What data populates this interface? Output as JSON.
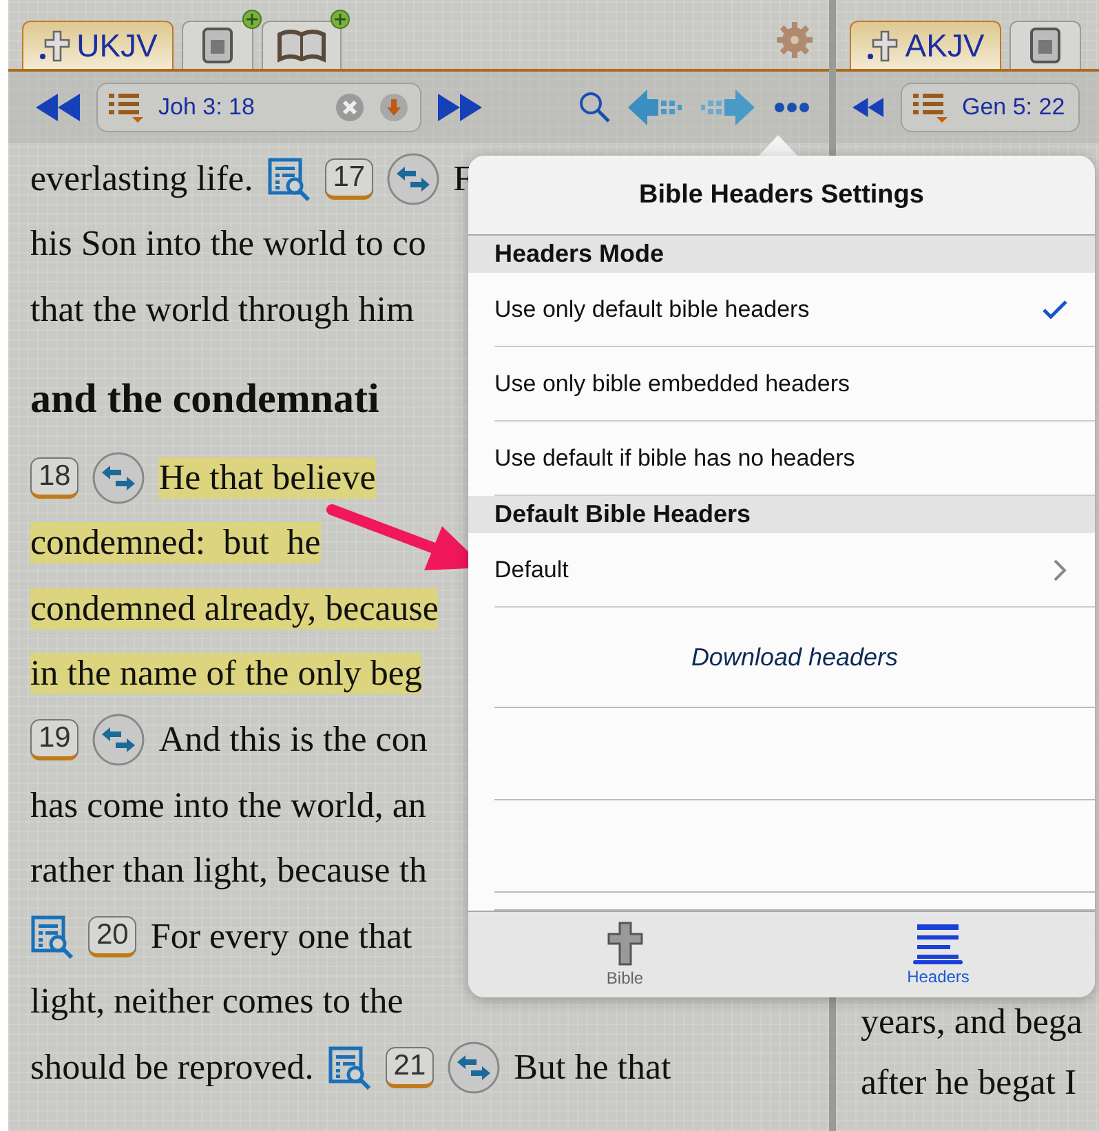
{
  "left_pane": {
    "tabs": [
      {
        "kind": "version",
        "label": "UKJV",
        "selected": true
      },
      {
        "kind": "notes",
        "selected": false
      },
      {
        "kind": "book",
        "selected": false
      }
    ],
    "reference": "Joh 3: 18",
    "lines": [
      {
        "highlighted": false,
        "parts": [
          {
            "kind": "text",
            "text": "everlasting life."
          },
          {
            "kind": "study"
          },
          {
            "kind": "verse",
            "text": "17"
          },
          {
            "kind": "xref"
          },
          {
            "kind": "text",
            "text": "F"
          }
        ]
      },
      {
        "highlighted": false,
        "parts": [
          {
            "kind": "text",
            "text": "his Son into the world to co"
          }
        ]
      },
      {
        "highlighted": false,
        "parts": [
          {
            "kind": "text",
            "text": "that the world through him"
          }
        ]
      },
      {
        "highlighted": false,
        "parts": [
          {
            "kind": "heading",
            "text": "and the condemnati"
          }
        ]
      },
      {
        "highlighted": true,
        "parts": [
          {
            "kind": "verse",
            "text": "18"
          },
          {
            "kind": "xref"
          },
          {
            "kind": "text",
            "text": "He that believe"
          }
        ]
      },
      {
        "highlighted": true,
        "parts": [
          {
            "kind": "text",
            "text": "condemned:  but  he"
          }
        ]
      },
      {
        "highlighted": true,
        "parts": [
          {
            "kind": "text",
            "text": "condemned already, because"
          }
        ]
      },
      {
        "highlighted": true,
        "parts": [
          {
            "kind": "text",
            "text": "in the name of the only beg"
          }
        ]
      },
      {
        "highlighted": false,
        "parts": [
          {
            "kind": "verse",
            "text": "19"
          },
          {
            "kind": "xref"
          },
          {
            "kind": "text",
            "text": "And this is the con"
          }
        ]
      },
      {
        "highlighted": false,
        "parts": [
          {
            "kind": "text",
            "text": "has come into the world, an"
          }
        ]
      },
      {
        "highlighted": false,
        "parts": [
          {
            "kind": "text",
            "text": "rather than light, because th"
          }
        ]
      },
      {
        "highlighted": false,
        "parts": [
          {
            "kind": "study"
          },
          {
            "kind": "verse",
            "text": "20"
          },
          {
            "kind": "text",
            "text": "For every one that"
          }
        ]
      },
      {
        "highlighted": false,
        "parts": [
          {
            "kind": "text",
            "text": "light, neither comes to the"
          }
        ]
      },
      {
        "highlighted": false,
        "parts": [
          {
            "kind": "text",
            "text": "should be reproved."
          },
          {
            "kind": "study"
          },
          {
            "kind": "verse",
            "text": "21"
          },
          {
            "kind": "xref"
          },
          {
            "kind": "text",
            "text": "But he that"
          }
        ]
      }
    ]
  },
  "right_pane": {
    "tabs": [
      {
        "kind": "version",
        "label": "AKJV",
        "selected": true
      },
      {
        "kind": "notes",
        "selected": false
      }
    ],
    "reference": "Gen 5: 22",
    "lines": [
      "years, and bega",
      "after he begat I"
    ]
  },
  "popover": {
    "title": "Bible Headers Settings",
    "sections": [
      {
        "title": "Headers Mode",
        "rows": [
          {
            "kind": "check",
            "label": "Use only default bible headers",
            "checked": true
          },
          {
            "kind": "check",
            "label": "Use only bible embedded headers",
            "checked": false
          },
          {
            "kind": "check",
            "label": "Use default if bible has no headers",
            "checked": false
          }
        ]
      },
      {
        "title": "Default Bible Headers",
        "rows": [
          {
            "kind": "disclosure",
            "label": "Default"
          }
        ]
      }
    ],
    "action": "Download headers",
    "tabs": [
      {
        "kind": "bible",
        "label": "Bible",
        "selected": false
      },
      {
        "kind": "headers",
        "label": "Headers",
        "selected": true
      }
    ]
  }
}
